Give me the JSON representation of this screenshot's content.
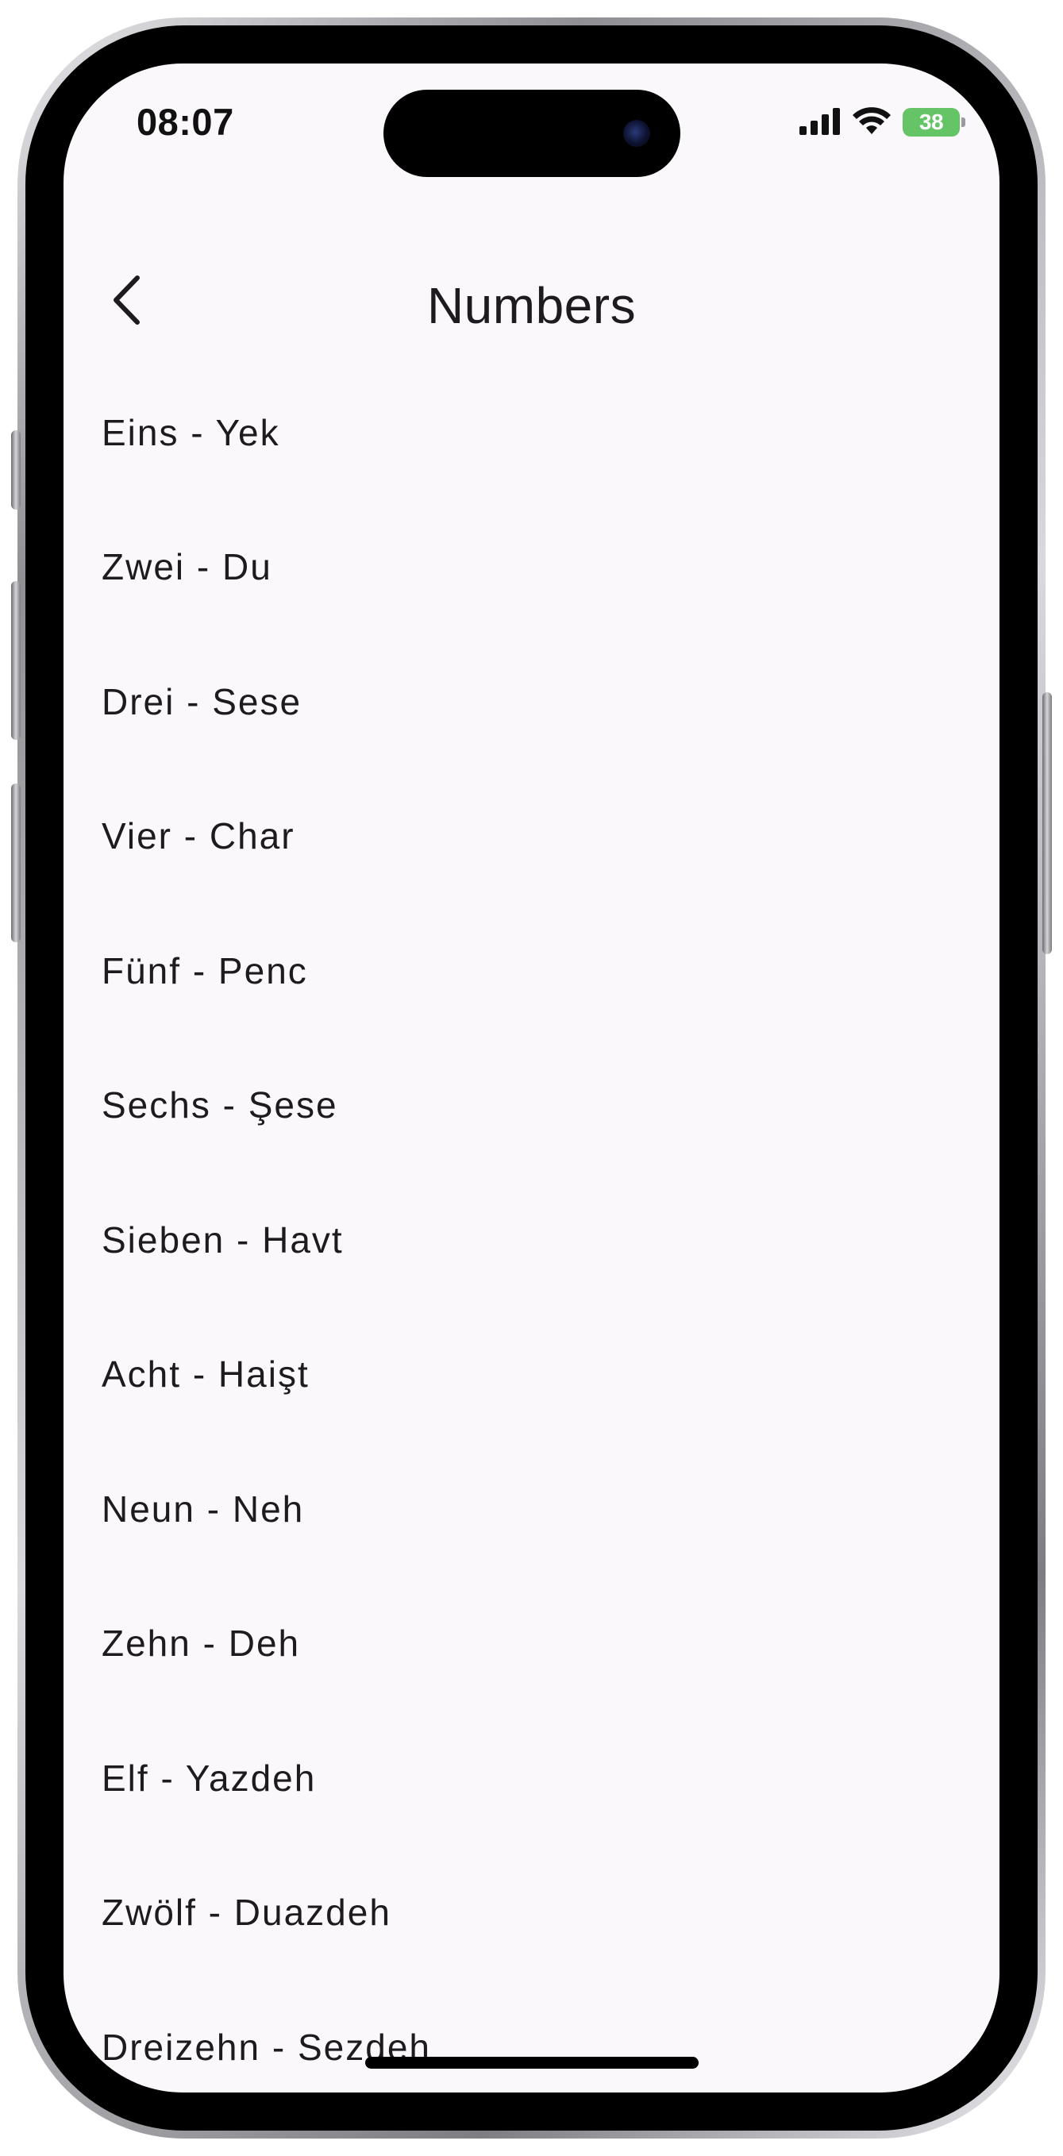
{
  "status_bar": {
    "time": "08:07",
    "battery": "38",
    "icons": [
      "cellular-signal-icon",
      "wifi-icon",
      "battery-charging-icon"
    ]
  },
  "nav": {
    "back_icon": "chevron-left-icon",
    "title": "Numbers"
  },
  "items": [
    {
      "label": "Eins - Yek"
    },
    {
      "label": "Zwei - Du"
    },
    {
      "label": "Drei - Sese"
    },
    {
      "label": "Vier - Char"
    },
    {
      "label": "Fünf - Penc"
    },
    {
      "label": "Sechs - Şese"
    },
    {
      "label": "Sieben - Havt"
    },
    {
      "label": "Acht - Haişt"
    },
    {
      "label": "Neun - Neh"
    },
    {
      "label": "Zehn - Deh"
    },
    {
      "label": "Elf - Yazdeh"
    },
    {
      "label": "Zwölf - Duazdeh"
    },
    {
      "label": "Dreizehn - Sezdeh"
    }
  ],
  "colors": {
    "background": "#fbf8fc",
    "text": "#1d1b20",
    "battery": "#65c466"
  }
}
